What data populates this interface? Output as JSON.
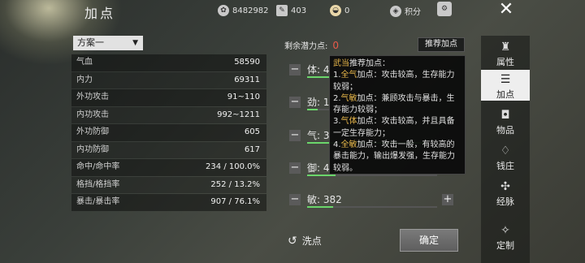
{
  "header": {
    "title": "加点",
    "silver": "8482982",
    "scroll": "403",
    "ingot": "0",
    "points_label": "积分"
  },
  "plan": {
    "selected": "方案一"
  },
  "stats": [
    {
      "label": "气血",
      "value": "58590"
    },
    {
      "label": "内力",
      "value": "69311"
    },
    {
      "label": "外功攻击",
      "value": "91~110"
    },
    {
      "label": "内功攻击",
      "value": "992~1211"
    },
    {
      "label": "外功防御",
      "value": "605"
    },
    {
      "label": "内功防御",
      "value": "617"
    },
    {
      "label": "命中/命中率",
      "value": "234 / 100.0%"
    },
    {
      "label": "格挡/格挡率",
      "value": "252 / 13.2%"
    },
    {
      "label": "暴击/暴击率",
      "value": "907 / 76.1%"
    }
  ],
  "allocate": {
    "remaining_label": "剩余潜力点:",
    "remaining_value": "0",
    "recommend_button": "推荐加点",
    "attrs": [
      {
        "label": "体: 4",
        "fill": 0.22
      },
      {
        "label": "劲: 1",
        "fill": 0.08
      },
      {
        "label": "气: 3",
        "fill": 0.9
      },
      {
        "label": "御: 4",
        "fill": 0.22
      },
      {
        "label": "敏: 382",
        "fill": 0.2
      }
    ],
    "reset_label": "洗点",
    "confirm_label": "确定"
  },
  "tooltip": {
    "lines": [
      {
        "hl": "武当",
        "rest": "推荐加点："
      },
      {
        "hl": "",
        "rest": "1."
      },
      {
        "hl": "全气",
        "rest": "加点：攻击较高，生存能力较弱；"
      },
      {
        "hl": "",
        "rest": "2."
      },
      {
        "hl": "气敏",
        "rest": "加点：兼顾攻击与暴击，生存能力较弱；"
      },
      {
        "hl": "",
        "rest": "3."
      },
      {
        "hl": "气体",
        "rest": "加点：攻击较高，并且具备一定生存能力；"
      },
      {
        "hl": "",
        "rest": "4."
      },
      {
        "hl": "全敏",
        "rest": "加点：攻击一般，有较高的暴击能力，输出爆发强，生存能力较弱。"
      }
    ]
  },
  "sidebar": {
    "items": [
      {
        "label": "属性",
        "icon": "hat-icon"
      },
      {
        "label": "加点",
        "icon": "sliders-icon"
      },
      {
        "label": "物品",
        "icon": "bag-icon"
      },
      {
        "label": "钱庄",
        "icon": "money-bag-icon"
      },
      {
        "label": "经脉",
        "icon": "meridian-icon"
      },
      {
        "label": "定制",
        "icon": "wand-icon"
      }
    ]
  }
}
